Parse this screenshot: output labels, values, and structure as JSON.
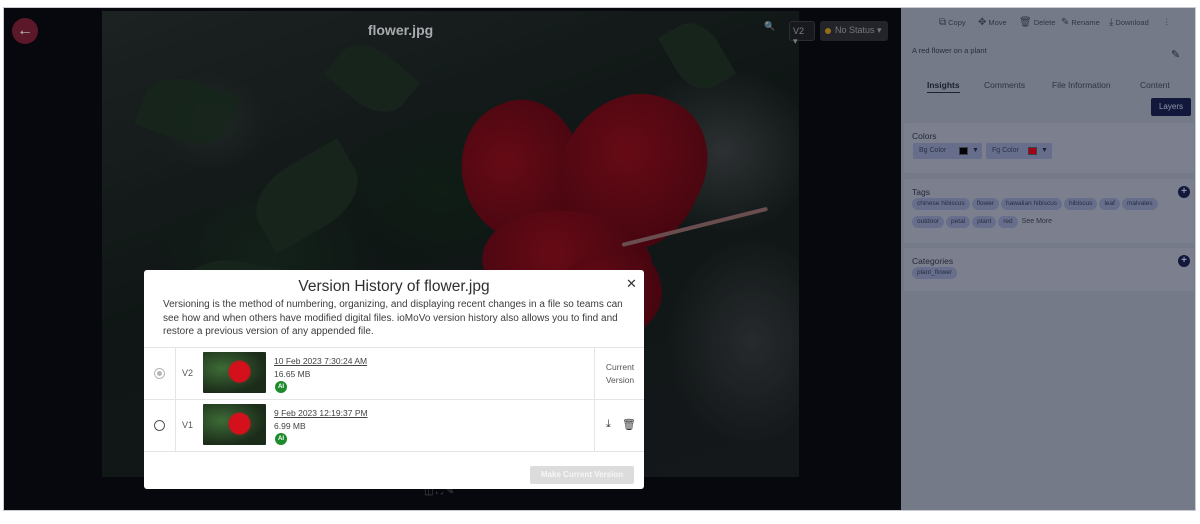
{
  "viewer": {
    "file_title": "flower.jpg",
    "version_selected": "V2",
    "status": "No Status"
  },
  "panel": {
    "toolbar": {
      "copy": "Copy",
      "move": "Move",
      "delete": "Delete",
      "rename": "Rename",
      "download": "Download"
    },
    "description": "A red flower on a plant",
    "tabs": [
      "Insights",
      "Comments",
      "File Information",
      "Content"
    ],
    "active_tab": "Insights",
    "layers_label": "Layers",
    "colors": {
      "title": "Colors",
      "bg_label": "Bg Color",
      "bg_value": "#000000",
      "fg_label": "Fg Color",
      "fg_value": "#e10012"
    },
    "tags": {
      "title": "Tags",
      "items": [
        "chinese hibiscus",
        "flower",
        "hawaiian hibiscus",
        "hibiscus",
        "leaf",
        "malvales",
        "outdoor",
        "petal",
        "plant",
        "red"
      ],
      "see_more": "See More"
    },
    "categories": {
      "title": "Categories",
      "items": [
        "plant_flower"
      ]
    }
  },
  "modal": {
    "title": "Version History of flower.jpg",
    "description": "Versioning is the method of numbering, organizing, and displaying recent changes in a file so teams can see how and when others have modified digital files. ioMoVo version history also allows you to find and restore a previous version of any appended file.",
    "versions": [
      {
        "label": "V2",
        "date": "10 Feb 2023 7:30:24 AM",
        "size": "16.65 MB",
        "badge": "AI",
        "current_label": "Current Version",
        "selected": true
      },
      {
        "label": "V1",
        "date": "9 Feb 2023 12:19:37 PM",
        "size": "6.99 MB",
        "badge": "AI",
        "selected": false
      }
    ],
    "make_current_label": "Make Current Version"
  },
  "colors": {
    "accent": "#161e48",
    "back_button": "#7a1e2e",
    "ai_badge": "#1d8a2b",
    "status_dot": "#c89614"
  }
}
